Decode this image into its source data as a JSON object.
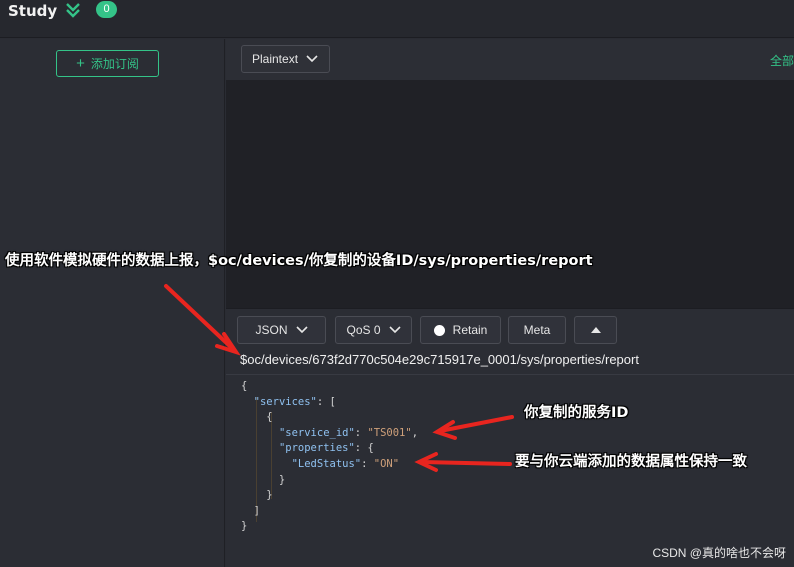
{
  "header": {
    "title": "Study",
    "count": "0",
    "collapse_icon": "double-chevron-down-icon"
  },
  "sidebar": {
    "add_subscription_label": "添加订阅"
  },
  "main": {
    "format_select": "Plaintext",
    "all_label": "全部"
  },
  "publish": {
    "payload_format": "JSON",
    "qos": "QoS 0",
    "retain_label": "Retain",
    "meta_label": "Meta",
    "topic": "$oc/devices/673f2d770c504e29c715917e_0001/sys/properties/report",
    "payload": {
      "services_key": "\"services\"",
      "service_id_key": "\"service_id\"",
      "service_id_value": "\"TS001\"",
      "properties_key": "\"properties\"",
      "led_key": "\"LedStatus\"",
      "led_value": "\"ON\""
    }
  },
  "annotations": {
    "topic_note": "使用软件模拟硬件的数据上报，$oc/devices/你复制的设备ID/sys/properties/report",
    "service_note": "你复制的服务ID",
    "property_note": "要与你云端添加的数据属性保持一致"
  },
  "watermark": "CSDN @真的啥也不会呀",
  "colors": {
    "accent": "#34c388",
    "arrow": "#e8251f"
  }
}
